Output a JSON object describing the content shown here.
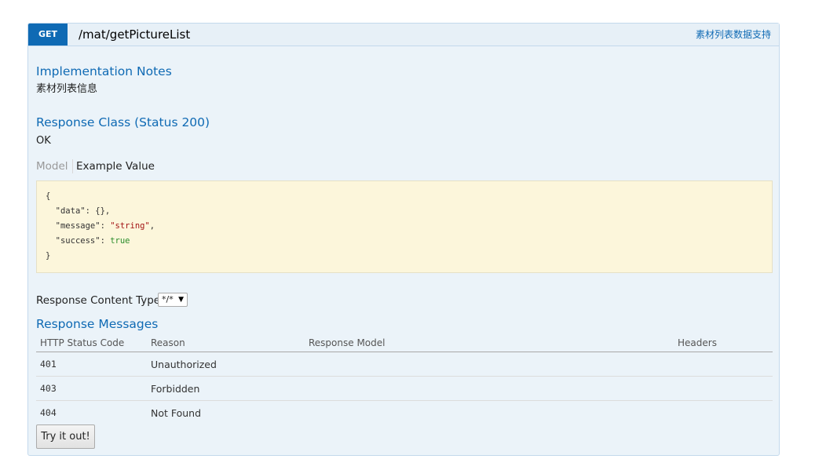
{
  "operation": {
    "method": "GET",
    "path": "/mat/getPictureList",
    "summary": "素材列表数据支持"
  },
  "implementation_notes": {
    "heading": "Implementation Notes",
    "text": "素材列表信息"
  },
  "response_class": {
    "heading": "Response Class (Status 200)",
    "text": "OK"
  },
  "tabs": {
    "model": "Model",
    "example": "Example Value"
  },
  "example_json": {
    "open": "{",
    "data_key": "\"data\"",
    "data_val": "{},",
    "message_key": "\"message\"",
    "message_val": "\"string\"",
    "message_comma": ",",
    "success_key": "\"success\"",
    "success_val": "true",
    "close": "}"
  },
  "content_type": {
    "label": "Response Content Type",
    "selected": "*/*"
  },
  "response_messages": {
    "heading": "Response Messages",
    "columns": [
      "HTTP Status Code",
      "Reason",
      "Response Model",
      "Headers"
    ],
    "rows": [
      {
        "code": "401",
        "reason": "Unauthorized",
        "model": "",
        "headers": ""
      },
      {
        "code": "403",
        "reason": "Forbidden",
        "model": "",
        "headers": ""
      },
      {
        "code": "404",
        "reason": "Not Found",
        "model": "",
        "headers": ""
      }
    ]
  },
  "try_button": "Try it out!",
  "colors": {
    "method_get": "#0f6ab4",
    "panel_bg": "#ebf3f9",
    "heading_blue": "#0f6ab4",
    "snippet_bg": "#fcf6db"
  }
}
